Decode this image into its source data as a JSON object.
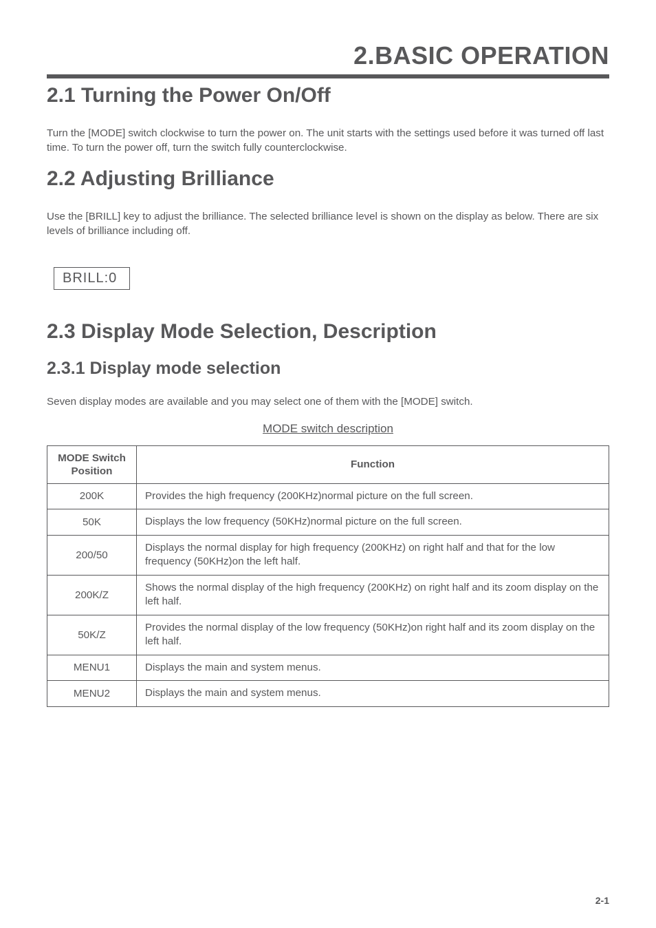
{
  "chapter_title": "2.BASIC OPERATION",
  "sec21": {
    "title": "2.1 Turning the Power On/Off",
    "para": "Turn the [MODE] switch clockwise to turn the power on. The unit starts with the settings used before it was turned off last time. To turn the power off, turn the switch fully counterclockwise."
  },
  "sec22": {
    "title": "2.2  Adjusting Brilliance",
    "para": "Use the [BRILL] key to adjust the brilliance. The selected brilliance level is shown on the display as below. There are six levels of brilliance including off.",
    "brill_box": "BRILL:0"
  },
  "sec23": {
    "title": "2.3  Display Mode Selection, Description",
    "sub_title": "2.3.1  Display mode selection",
    "para": "Seven display modes are available and you may select one of them with the [MODE] switch.",
    "table_caption": "MODE switch description",
    "table": {
      "headers": {
        "pos": "MODE Switch Position",
        "fn": "Function"
      },
      "rows": [
        {
          "pos": "200K",
          "fn": "Provides the high frequency (200KHz)normal picture on the full screen."
        },
        {
          "pos": "50K",
          "fn": "Displays the low frequency (50KHz)normal picture on the full screen."
        },
        {
          "pos": "200/50",
          "fn": "Displays the normal display for high frequency (200KHz) on right half and that for the low frequency (50KHz)on the left half."
        },
        {
          "pos": "200K/Z",
          "fn": "Shows the normal display of the high frequency (200KHz) on right half and its zoom display on the left half."
        },
        {
          "pos": "50K/Z",
          "fn": "Provides the normal display of the low frequency (50KHz)on right half and its zoom display on the left half."
        },
        {
          "pos": "MENU1",
          "fn": "Displays the main and system menus."
        },
        {
          "pos": "MENU2",
          "fn": "Displays the main and system menus."
        }
      ]
    }
  },
  "page_num": "2-1"
}
